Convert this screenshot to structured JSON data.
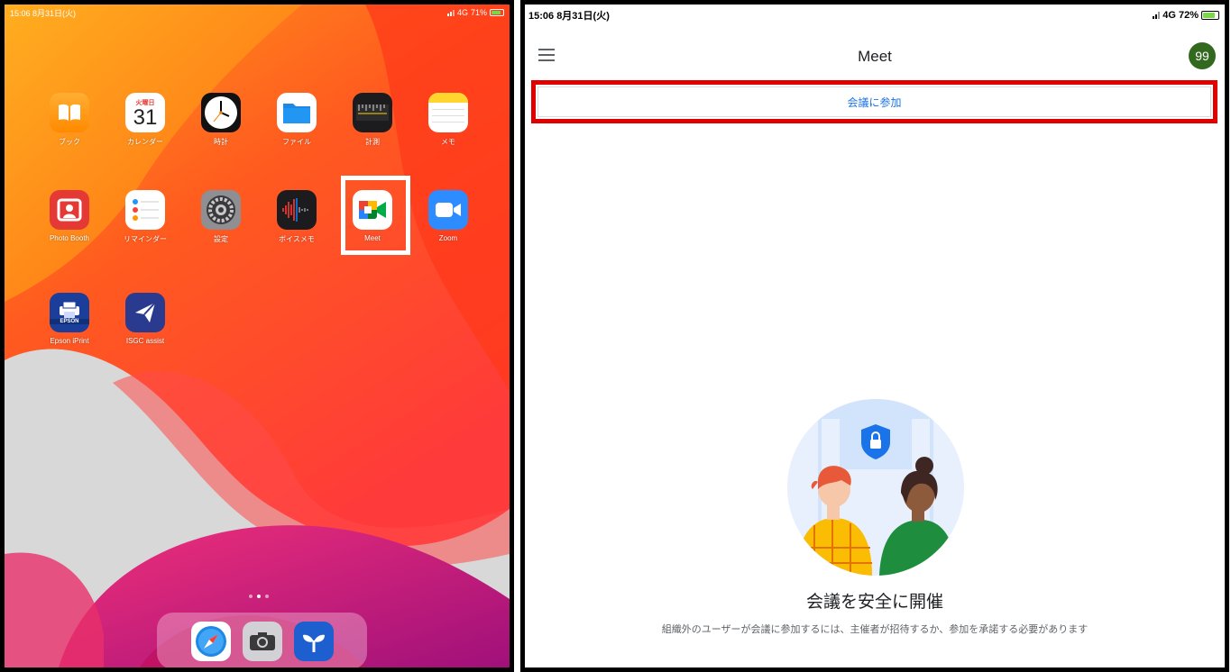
{
  "left_screen": {
    "status": {
      "time_date": "15:06  8月31日(火)",
      "network": "4G",
      "battery": "71%"
    },
    "calendar": {
      "weekday": "火曜日",
      "day": "31"
    },
    "apps_row1": [
      {
        "label": "ブック",
        "icon": "books-icon"
      },
      {
        "label": "カレンダー",
        "icon": "calendar-icon"
      },
      {
        "label": "時計",
        "icon": "clock-icon"
      },
      {
        "label": "ファイル",
        "icon": "files-icon"
      },
      {
        "label": "計測",
        "icon": "measure-icon"
      },
      {
        "label": "メモ",
        "icon": "notes-icon"
      }
    ],
    "apps_row2": [
      {
        "label": "Photo Booth",
        "icon": "photo-booth-icon"
      },
      {
        "label": "リマインダー",
        "icon": "reminders-icon"
      },
      {
        "label": "設定",
        "icon": "settings-icon"
      },
      {
        "label": "ボイスメモ",
        "icon": "voice-memos-icon"
      },
      {
        "label": "Meet",
        "icon": "meet-icon"
      },
      {
        "label": "Zoom",
        "icon": "zoom-icon"
      }
    ],
    "apps_row3": [
      {
        "label": "Epson iPrint",
        "icon": "epson-iprint-icon",
        "badge": "EPSON"
      },
      {
        "label": "ISGC assist",
        "icon": "isgc-assist-icon"
      }
    ],
    "dock": [
      "safari-icon",
      "camera-icon",
      "seedling-app-icon"
    ],
    "colors": {
      "highlight": "#ffffff"
    }
  },
  "right_screen": {
    "status": {
      "time_date": "15:06  8月31日(火)",
      "network": "4G",
      "battery": "72%"
    },
    "title": "Meet",
    "avatar": "99",
    "join_button": "会議に参加",
    "promo_title": "会議を安全に開催",
    "promo_body": "組織外のユーザーが会議に参加するには、主催者が招待するか、参加を承諾する必要があります",
    "colors": {
      "accent": "#1a73e8",
      "highlight": "#e00000",
      "avatar": "#33691e"
    }
  }
}
